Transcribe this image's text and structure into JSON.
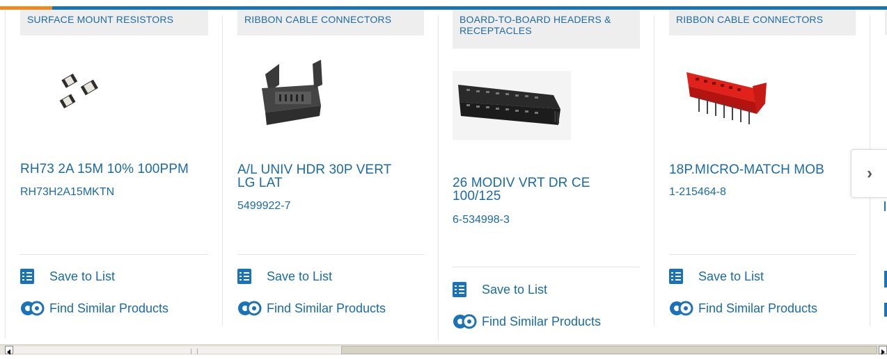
{
  "cards": [
    {
      "category": "SURFACE MOUNT RESISTORS",
      "title": "RH73 2A 15M 10% 100PPM",
      "part_number": "RH73H2A15MKTN",
      "save_label": "Save to List",
      "similar_label": "Find Similar Products"
    },
    {
      "category": "RIBBON CABLE CONNECTORS",
      "title": "A/L UNIV HDR 30P VERT LG LAT",
      "part_number": "5499922-7",
      "save_label": "Save to List",
      "similar_label": "Find Similar Products"
    },
    {
      "category": "BOARD-TO-BOARD HEADERS & RECEPTACLES",
      "title": "26 MODIV VRT DR CE 100/125",
      "part_number": "6-534998-3",
      "save_label": "Save to List",
      "similar_label": "Find Similar Products"
    },
    {
      "category": "RIBBON CABLE CONNECTORS",
      "title": "18P.MICRO-MATCH MOB",
      "part_number": "1-215464-8",
      "save_label": "Save to List",
      "similar_label": "Find Similar Products"
    }
  ],
  "carousel": {
    "next_icon": "chevron-right-icon",
    "next_glyph": "›"
  },
  "colors": {
    "brand_blue": "#1a72b9",
    "accent_orange": "#f08a1c",
    "link_blue": "#1a6aa8",
    "category_bg": "#eeeeee"
  }
}
